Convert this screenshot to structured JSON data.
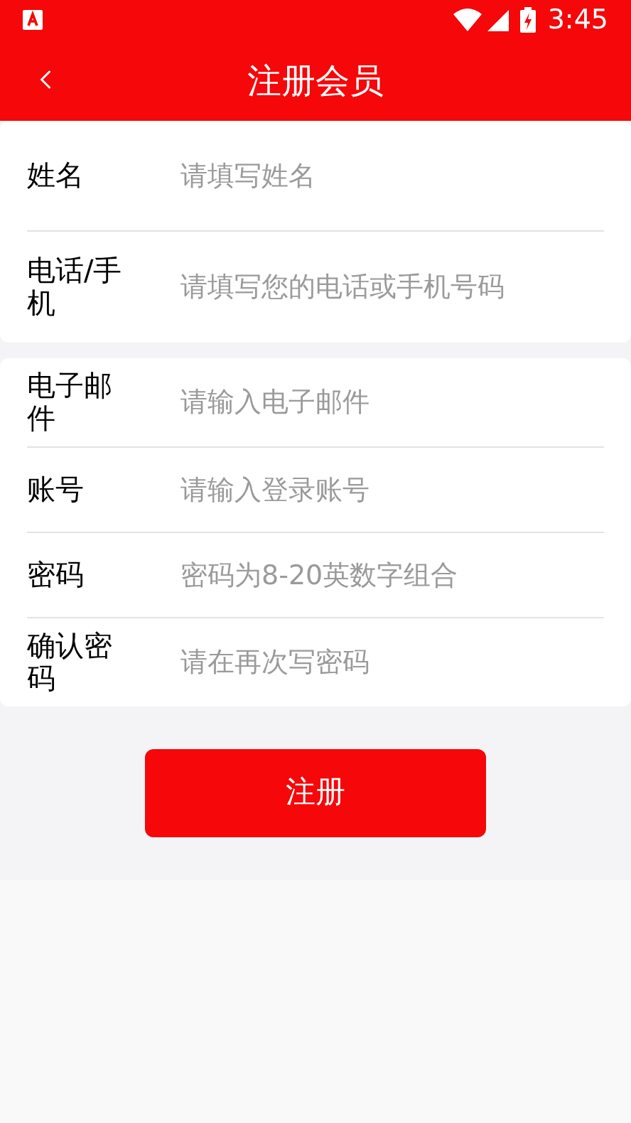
{
  "status_bar": {
    "time": "3:45"
  },
  "header": {
    "title": "注册会员"
  },
  "groups": [
    {
      "fields": [
        {
          "label": "姓名",
          "placeholder": "请填写姓名"
        },
        {
          "label": "电话/手机",
          "placeholder": "请填写您的电话或手机号码"
        }
      ]
    },
    {
      "fields": [
        {
          "label": "电子邮件",
          "placeholder": "请输入电子邮件"
        },
        {
          "label": "账号",
          "placeholder": "请输入登录账号"
        },
        {
          "label": "密码",
          "placeholder": "密码为8-20英数字组合"
        },
        {
          "label": "确认密码",
          "placeholder": "请在再次写密码"
        }
      ]
    }
  ],
  "submit": {
    "label": "注册"
  }
}
